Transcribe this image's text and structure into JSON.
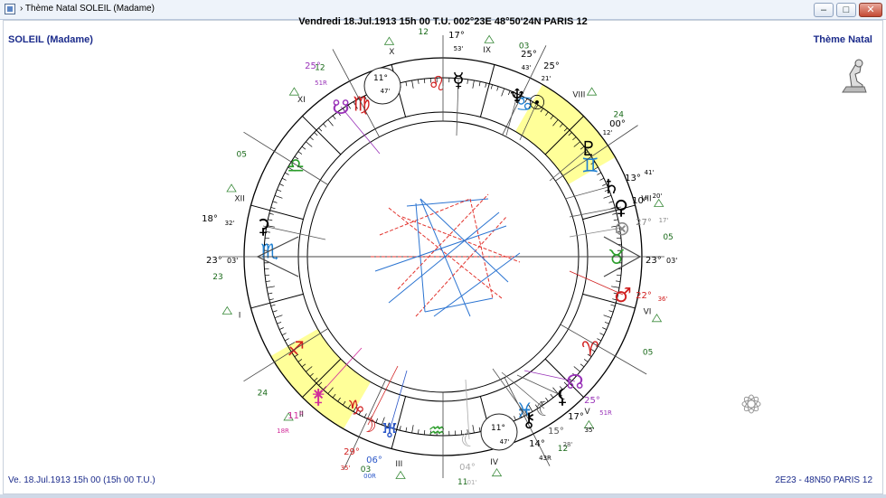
{
  "window": {
    "title": "› Thème Natal  SOLEIL (Madame)",
    "minimize_label": "–",
    "maximize_label": "□",
    "close_label": "✕"
  },
  "header": {
    "date_line": "Vendredi 18.Jul.1913 15h 00 T.U. 002°23E 48°50'24N  PARIS 12",
    "name": "SOLEIL (Madame)",
    "theme": "Thème Natal"
  },
  "footer": {
    "left": "Ve. 18.Jul.1913 15h 00 (15h 00 T.U.)",
    "right": "2E23 - 48N50  PARIS 12"
  },
  "colors": {
    "title_blue": "#1b2b8b",
    "aspect_red": "#e2332d",
    "aspect_blue": "#2b74d1",
    "highlight": "#ffff99"
  },
  "chart": {
    "asc_deg": "23°",
    "asc_min": "03'",
    "desc_deg": "23°",
    "desc_min": "03'",
    "houses": [
      "I",
      "II",
      "III",
      "IV",
      "V",
      "VI",
      "VII",
      "VIII",
      "IX",
      "X",
      "XI",
      "XII"
    ],
    "cusp_degrees": [
      "23",
      "24",
      "03",
      "11",
      "12",
      "05",
      "05",
      "24",
      "03",
      "12",
      "12",
      "05"
    ],
    "mc_deg": "11°",
    "mc_min": "47'",
    "ic_deg": "11°",
    "ic_min": "47'",
    "signs": [
      "♈",
      "♉",
      "♊",
      "♋",
      "♌",
      "♍",
      "♎",
      "♏",
      "♐",
      "♑",
      "♒",
      "♓"
    ],
    "planets": [
      {
        "name": "mercury",
        "glyph": "☿",
        "deg": "17°",
        "min": "53'"
      },
      {
        "name": "neptune",
        "glyph": "♆",
        "deg": "25°",
        "min": "43'"
      },
      {
        "name": "sun",
        "glyph": "☉",
        "deg": "25°",
        "min": "21'"
      },
      {
        "name": "pluto",
        "glyph": "♇",
        "deg": "00°",
        "min": "12'"
      },
      {
        "name": "saturn",
        "glyph": "♄",
        "deg": "13°",
        "min": "41'"
      },
      {
        "name": "venus",
        "glyph": "♀",
        "deg": "10°",
        "min": "20'"
      },
      {
        "name": "fortune",
        "glyph": "⊗",
        "deg": "27°",
        "min": "17'"
      },
      {
        "name": "mars",
        "glyph": "♂",
        "deg": "22°",
        "min": "36'"
      },
      {
        "name": "node",
        "glyph": "☊",
        "deg": "25°",
        "min": "51R"
      },
      {
        "name": "lilith",
        "glyph": "⚸",
        "deg": "17°",
        "min": "35'"
      },
      {
        "name": "lunar-m",
        "glyph": "☾",
        "deg": "15°",
        "min": "28'"
      },
      {
        "name": "chiron",
        "glyph": "⚷",
        "deg": "14°",
        "min": "43R"
      },
      {
        "name": "moon-c",
        "glyph": "☾",
        "deg": "04°",
        "min": "01'"
      },
      {
        "name": "uranus",
        "glyph": "♅",
        "deg": "06°",
        "min": "00R"
      },
      {
        "name": "moon",
        "glyph": "☽",
        "deg": "29°",
        "min": "35'"
      },
      {
        "name": "juno",
        "glyph": "⚵",
        "deg": "11°",
        "min": "18R"
      },
      {
        "name": "ceres",
        "glyph": "⚳",
        "deg": "18°",
        "min": "32'"
      },
      {
        "name": "south-node",
        "glyph": "☋",
        "deg": "25°",
        "min": "51R"
      }
    ]
  }
}
